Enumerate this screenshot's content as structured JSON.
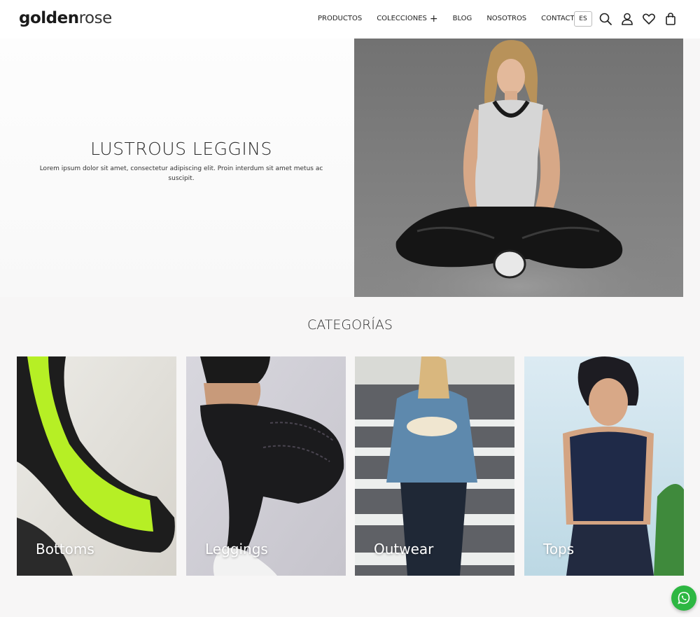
{
  "header": {
    "logo_part1": "golden",
    "logo_part2": "rose",
    "nav": [
      {
        "label": "PRODUCTOS"
      },
      {
        "label": "COLECCIONES"
      },
      {
        "label": "BLOG"
      },
      {
        "label": "NOSOTROS"
      },
      {
        "label": "CONTACTO"
      }
    ],
    "expand_glyph": "+",
    "language": "ES",
    "icons": [
      "search-icon",
      "user-icon",
      "heart-icon",
      "bag-icon"
    ]
  },
  "hero": {
    "title": "LUSTROUS LEGGINS",
    "text": "Lorem ipsum dolor sit amet, consectetur adipiscing elit. Proin interdum sit amet metus ac suscipit."
  },
  "categories": {
    "title": "CATEGORÍAS",
    "items": [
      {
        "label": "Bottoms"
      },
      {
        "label": "Leggings"
      },
      {
        "label": "Outwear"
      },
      {
        "label": "Tops"
      }
    ]
  },
  "colors": {
    "background": "#f7f6f6",
    "header": "#ffffff",
    "whatsapp": "#2db742"
  }
}
